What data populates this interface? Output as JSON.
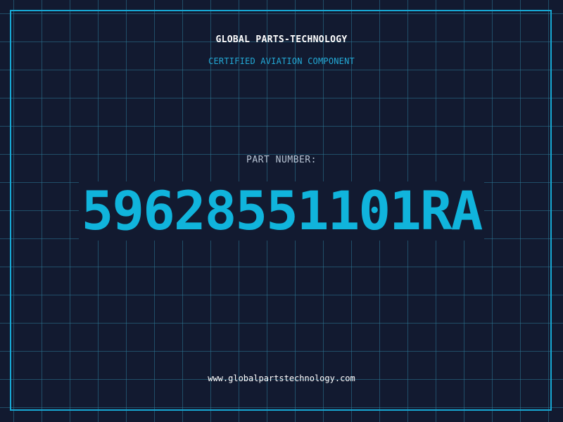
{
  "header": {
    "company": "GLOBAL PARTS-TECHNOLOGY",
    "subtitle": "CERTIFIED AVIATION COMPONENT"
  },
  "part": {
    "label": "PART NUMBER:",
    "number": "59628551101RA"
  },
  "footer": {
    "website": "www.globalpartstechnology.com"
  },
  "colors": {
    "background": "#121a30",
    "grid": "#2d7896",
    "frame": "#17a8d4",
    "accent": "#10b4dc",
    "text": "#ffffff",
    "muted": "#b8c4d4"
  }
}
